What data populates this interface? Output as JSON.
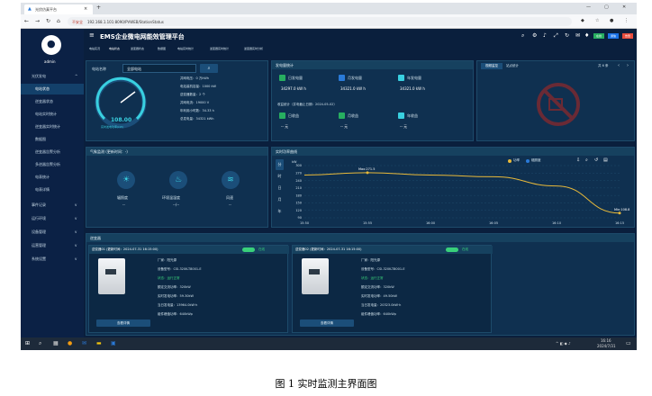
{
  "browser": {
    "tab_title": "光伏仿真平台",
    "address": "192.168.1.101:8090/PVWEB/StationStatus",
    "security_label": "不安全",
    "window_controls": [
      "—",
      "▢",
      "✕"
    ]
  },
  "app": {
    "title": "EMS企业微电网能效管理平台",
    "user": "admin",
    "top_tabs": [
      "电站实况",
      "电站状态",
      "逆变器状态",
      "数据图",
      "电站实时统计",
      "逆变器实时统计",
      "逆变器实时分析"
    ],
    "header_badges": [
      "在线",
      "通信",
      "告警"
    ]
  },
  "sidebar": {
    "items": [
      {
        "label": "光伏发电",
        "arrow": "^"
      },
      {
        "label": "电站状态",
        "arrow": ""
      },
      {
        "label": "逆变器状态",
        "arrow": ""
      },
      {
        "label": "电站实时统计",
        "arrow": ""
      },
      {
        "label": "逆变器实时统计",
        "arrow": ""
      },
      {
        "label": "数据图",
        "arrow": ""
      },
      {
        "label": "逆变器告警分析",
        "arrow": ""
      },
      {
        "label": "多逆器告警分析",
        "arrow": ""
      },
      {
        "label": "电表统计",
        "arrow": ""
      },
      {
        "label": "电表详情",
        "arrow": ""
      },
      {
        "label": "事件记录",
        "arrow": "v"
      },
      {
        "label": "运行环境",
        "arrow": "v"
      },
      {
        "label": "设备管理",
        "arrow": "v"
      },
      {
        "label": "运营管理",
        "arrow": "v"
      },
      {
        "label": "系统设置",
        "arrow": "v"
      }
    ]
  },
  "station": {
    "name_label": "电站名称",
    "name_value": "全部电站",
    "gauge_value": "108.00",
    "gauge_caption": "实时发电功率(kW)",
    "info": [
      "并网电压：0 万kWh",
      "电站装机容量：1000 kW",
      "逆变器数量：2 个",
      "并网电流：19000 V",
      "年利用小时数：34.33 h",
      "总发电量：34321 kWh"
    ]
  },
  "generation": {
    "title": "发电量统计",
    "items": [
      {
        "label": "日发电量",
        "value": "34297.0 kW h"
      },
      {
        "label": "月发电量",
        "value": "34321.0 kW h"
      },
      {
        "label": "年发电量",
        "value": "34321.0 kW h"
      }
    ],
    "income_title": "收益统计（并电截止日期：2024-05-02）",
    "income": [
      {
        "label": "日收益",
        "value": "-- 元"
      },
      {
        "label": "月收益",
        "value": "-- 元"
      },
      {
        "label": "年收益",
        "value": "-- 元"
      }
    ]
  },
  "video": {
    "tabs": [
      "视频监控",
      "站点统计"
    ],
    "pager": "共 6 条"
  },
  "weather": {
    "title": "气象监测 (更新时间：-)",
    "items": [
      {
        "label": "辐照度",
        "value": "--"
      },
      {
        "label": "环境温湿度",
        "value": "--/--"
      },
      {
        "label": "风速",
        "value": "--"
      }
    ]
  },
  "power_chart": {
    "title": "实时功率曲线",
    "period_buttons": [
      "分",
      "时",
      "日",
      "月",
      "年"
    ],
    "legend": [
      "功率",
      "辐照度"
    ],
    "annotations": [
      "Max:271.5",
      "Min:108.8"
    ]
  },
  "chart_data": {
    "type": "line",
    "title": "",
    "ylabel": "kW",
    "xlabel": "",
    "x": [
      "15:50",
      "15:55",
      "16:00",
      "16:05",
      "16:10",
      "16:15"
    ],
    "ylim": [
      90,
      300
    ],
    "yticks": [
      90,
      120,
      150,
      180,
      210,
      240,
      270,
      300
    ],
    "series": [
      {
        "name": "功率",
        "values": [
          262,
          271.5,
          262,
          255,
          218,
          108.8
        ]
      }
    ]
  },
  "inverters": {
    "title": "逆变器",
    "cards": [
      {
        "title": "逆变器01 (更新时间：2024-07-31 16:15:00)",
        "status_badge": "在线",
        "fields": [
          "厂家：阳光源",
          "设备型号：CSI-320K-T8001-E",
          "状态：运行正常",
          "额定交流功率：320kW",
          "实时发电功率：59.30kW",
          "当日发电量：13964.0kW·h",
          "组件峰值功率：640kWp"
        ],
        "detail_button": "查看详情"
      },
      {
        "title": "逆变器02 (更新时间：2024-07-31 16:15:00)",
        "status_badge": "在线",
        "fields": [
          "厂家：阳光源",
          "设备型号：CSI-320K-T8001-E",
          "状态：运行正常",
          "额定交流功率：320kW",
          "实时发电功率：49.50kW",
          "当日发电量：20323.0kW·h",
          "组件峰值功率：640kWp"
        ],
        "detail_button": "查看详情"
      }
    ]
  },
  "taskbar": {
    "time": "16:16",
    "date": "2024/7/31"
  },
  "caption": "图 1  实时监测主界面图",
  "colors": {
    "background": "#0a1f3d",
    "panel": "#0f3050",
    "accent": "#39d0e0",
    "line": "#e8b93a"
  }
}
